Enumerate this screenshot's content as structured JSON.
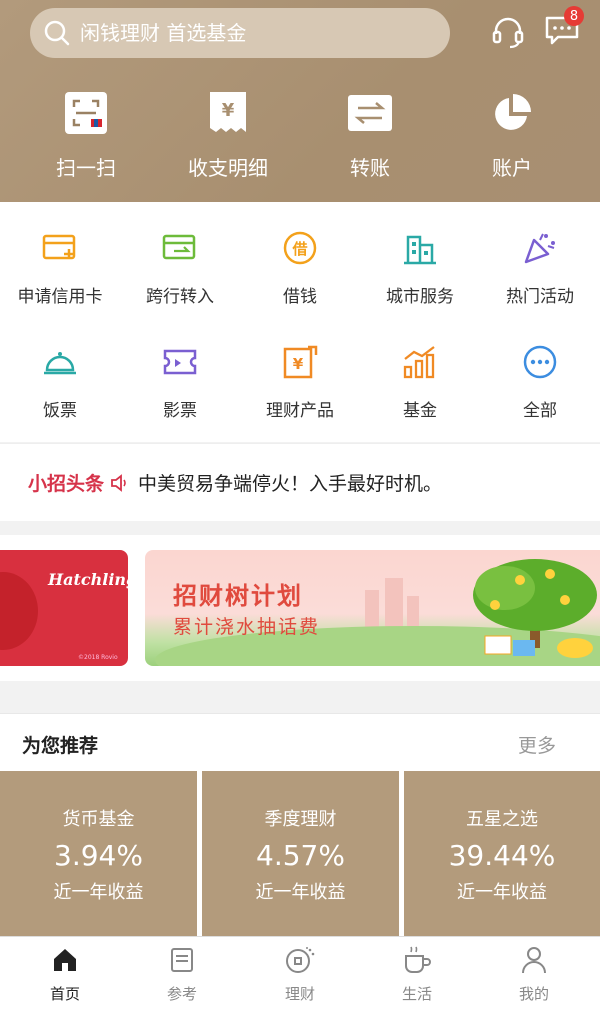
{
  "header": {
    "search": {
      "placeholder": "闲钱理财 首选基金",
      "icon": "search-icon"
    },
    "headset_icon": "headset-icon",
    "message": {
      "icon": "message-icon",
      "badge": "8"
    },
    "quick_actions": [
      {
        "label": "扫一扫",
        "icon": "scan-icon"
      },
      {
        "label": "收支明细",
        "icon": "receipt-icon"
      },
      {
        "label": "转账",
        "icon": "transfer-icon"
      },
      {
        "label": "账户",
        "icon": "pie-chart-icon"
      }
    ]
  },
  "services": [
    {
      "label": "申请信用卡",
      "icon": "credit-card-add-icon",
      "color": "#f3a11b"
    },
    {
      "label": "跨行转入",
      "icon": "interbank-card-icon",
      "color": "#6dbb3a"
    },
    {
      "label": "借钱",
      "icon": "borrow-icon",
      "color": "#f3a11b"
    },
    {
      "label": "城市服务",
      "icon": "city-building-icon",
      "color": "#2aa9a6"
    },
    {
      "label": "热门活动",
      "icon": "party-popper-icon",
      "color": "#7a5fd1"
    },
    {
      "label": "饭票",
      "icon": "food-cloche-icon",
      "color": "#2aa9a6"
    },
    {
      "label": "影票",
      "icon": "movie-ticket-icon",
      "color": "#7a5fd1"
    },
    {
      "label": "理财产品",
      "icon": "wealth-product-icon",
      "color": "#f08a24"
    },
    {
      "label": "基金",
      "icon": "fund-chart-icon",
      "color": "#f08a24"
    },
    {
      "label": "全部",
      "icon": "more-dots-icon",
      "color": "#3c8de0"
    }
  ],
  "news": {
    "tag": "小招头条",
    "icon": "speaker-icon",
    "text": "中美贸易争端停火！入手最好时机。"
  },
  "banners": {
    "left": {
      "title": "Hatchlings",
      "copyright": "©2018 Rovio"
    },
    "right": {
      "title": "招财树计划",
      "subtitle": "累计浇水抽话费"
    }
  },
  "recommend": {
    "title": "为您推荐",
    "more": "更多",
    "cards": [
      {
        "name": "货币基金",
        "rate": "3.94%",
        "desc": "近一年收益"
      },
      {
        "name": "季度理财",
        "rate": "4.57%",
        "desc": "近一年收益"
      },
      {
        "name": "五星之选",
        "rate": "39.44%",
        "desc": "近一年收益"
      }
    ]
  },
  "tabs": [
    {
      "label": "首页",
      "icon": "home-icon",
      "active": true
    },
    {
      "label": "参考",
      "icon": "document-icon",
      "active": false
    },
    {
      "label": "理财",
      "icon": "coin-icon",
      "active": false
    },
    {
      "label": "生活",
      "icon": "coffee-cup-icon",
      "active": false
    },
    {
      "label": "我的",
      "icon": "user-icon",
      "active": false
    }
  ],
  "colors": {
    "header_bg": "#ab9274",
    "card_bg": "#b39b7c",
    "news_tag": "#d6334a",
    "badge": "#e63b35"
  }
}
